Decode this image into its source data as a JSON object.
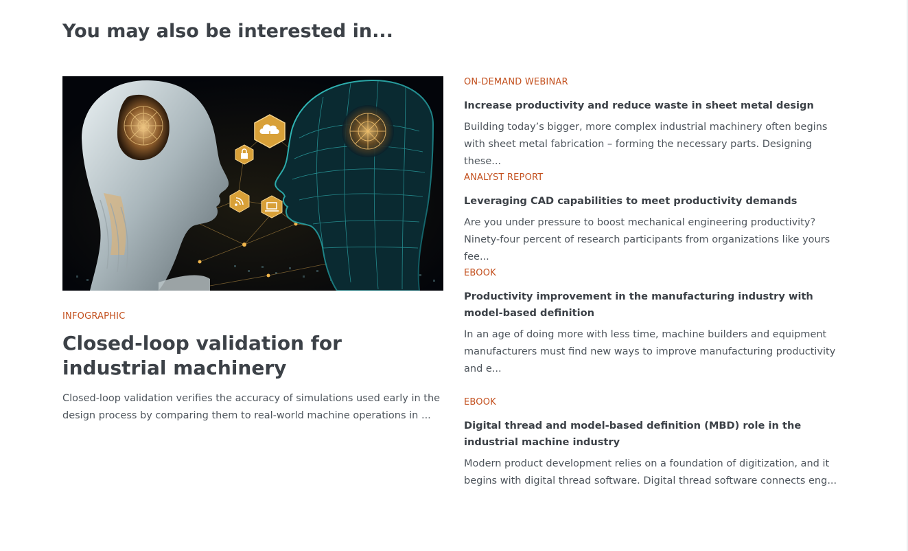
{
  "section": {
    "title": "You may also be interested in..."
  },
  "featured": {
    "tag": "INFOGRAPHIC",
    "title": "Closed-loop validation for industrial machinery",
    "description": "Closed-loop validation verifies the accuracy of simulations used early in the design process by comparing them to real-world machine operations in ..."
  },
  "items": [
    {
      "tag": "ON-DEMAND WEBINAR",
      "title": "Increase productivity and reduce waste in sheet metal design",
      "description": "Building today’s bigger, more complex industrial machinery often begins with sheet metal fabrication – forming the necessary parts. Designing these..."
    },
    {
      "tag": "ANALYST REPORT",
      "title": "Leveraging CAD capabilities to meet productivity demands",
      "description": "Are you under pressure to boost mechanical engineering productivity? Ninety-four percent of research participants from organizations like yours fee..."
    },
    {
      "tag": "EBOOK",
      "title": "Productivity improvement in the manufacturing industry with model-based definition",
      "description": "In an age of doing more with less time, machine builders and equipment manufacturers must find new ways to improve manufacturing productivity and e..."
    },
    {
      "tag": "EBOOK",
      "title": "Digital thread and model-based definition (MBD) role in the industrial machine industry",
      "description": "Modern product development relies on a foundation of digitization, and it begins with digital thread software. Digital thread software connects eng..."
    }
  ],
  "colors": {
    "accent": "#c3501e",
    "heading": "#3c4147",
    "body_text": "#4e555c",
    "hex_icon": "#d8a038",
    "wireframe": "#1fa7a8"
  },
  "icons": [
    "cloud-download-icon",
    "lock-icon",
    "wifi-icon",
    "laptop-icon"
  ]
}
